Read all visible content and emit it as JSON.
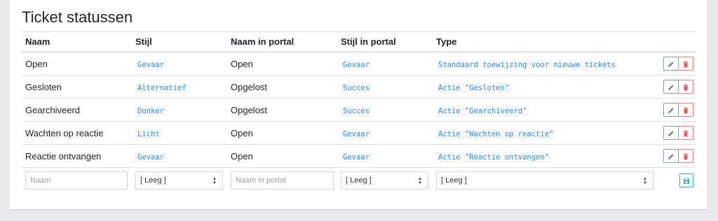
{
  "panel": {
    "title": "Ticket statussen"
  },
  "columns": {
    "naam": "Naam",
    "stijl": "Stijl",
    "naam_portal": "Naam in portal",
    "stijl_portal": "Stijl in portal",
    "type": "Type"
  },
  "rows": [
    {
      "naam": "Open",
      "stijl": "Gevaar",
      "naam_portal": "Open",
      "stijl_portal": "Gevaar",
      "type": "Standaard toewijzing voor nieuwe tickets"
    },
    {
      "naam": "Gesloten",
      "stijl": "Alternatief",
      "naam_portal": "Opgelost",
      "stijl_portal": "Succes",
      "type": "Actie \"Gesloten\""
    },
    {
      "naam": "Gearchiveerd",
      "stijl": "Donker",
      "naam_portal": "Opgelost",
      "stijl_portal": "Succes",
      "type": "Actie \"Gearchiveerd\""
    },
    {
      "naam": "Wachten op reactie",
      "stijl": "Licht",
      "naam_portal": "Open",
      "stijl_portal": "Gevaar",
      "type": "Actie \"Wachten op reactie\""
    },
    {
      "naam": "Reactie ontvangen",
      "stijl": "Gevaar",
      "naam_portal": "Open",
      "stijl_portal": "Gevaar",
      "type": "Actie \"Reactie ontvangen\""
    }
  ],
  "new_row": {
    "naam_placeholder": "Naam",
    "stijl_value": "[ Leeg ]",
    "naam_portal_placeholder": "Naam in portal",
    "stijl_portal_value": "[ Leeg ]",
    "type_value": "[ Leeg ]"
  },
  "icons": {
    "edit": "pencil-icon",
    "delete": "trash-icon",
    "save": "floppy-disk-icon",
    "select_caret": "up-down-caret-icon"
  },
  "colors": {
    "code_text": "#3b8fd6",
    "delete": "#e05a5a",
    "save": "#3fa5d8",
    "edit": "#6c7a86"
  }
}
